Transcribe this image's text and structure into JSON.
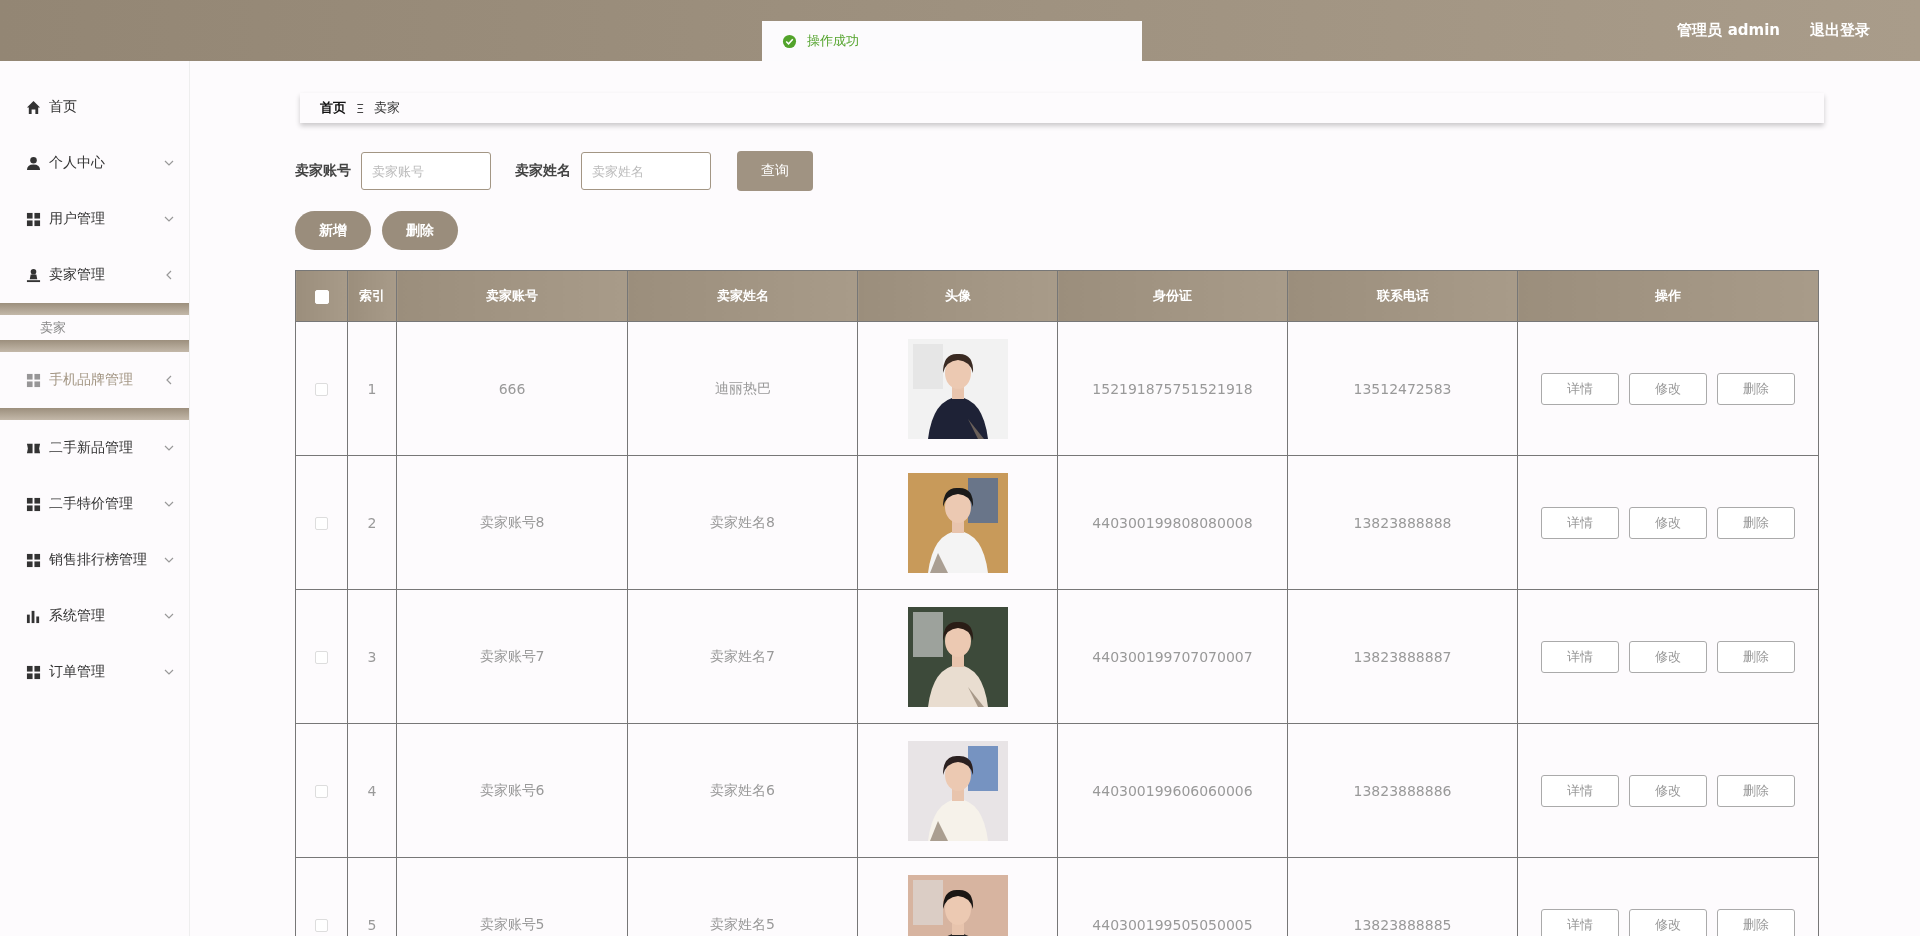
{
  "header": {
    "user": "管理员 admin",
    "logout": "退出登录"
  },
  "toast": {
    "message": "操作成功"
  },
  "sidebar": {
    "items": [
      {
        "label": "首页",
        "highlighted": false
      },
      {
        "label": "个人中心",
        "expanded": false,
        "highlighted": false
      },
      {
        "label": "用户管理",
        "expanded": false,
        "highlighted": false
      },
      {
        "label": "卖家管理",
        "expanded": true,
        "highlighted": false,
        "children": [
          {
            "label": "卖家"
          }
        ]
      },
      {
        "label": "手机品牌管理",
        "expanded": true,
        "highlighted": true
      },
      {
        "label": "二手新品管理",
        "expanded": false,
        "highlighted": false
      },
      {
        "label": "二手特价管理",
        "expanded": false,
        "highlighted": false
      },
      {
        "label": "销售排行榜管理",
        "expanded": false,
        "highlighted": false
      },
      {
        "label": "系统管理",
        "expanded": false,
        "highlighted": false
      },
      {
        "label": "订单管理",
        "expanded": false,
        "highlighted": false
      }
    ]
  },
  "breadcrumb": {
    "items": [
      "首页",
      "卖家"
    ],
    "separator": "Ξ"
  },
  "search": {
    "fields": [
      {
        "label": "卖家账号",
        "placeholder": "卖家账号"
      },
      {
        "label": "卖家姓名",
        "placeholder": "卖家姓名"
      }
    ],
    "button": "查询"
  },
  "actions": [
    "新增",
    "删除"
  ],
  "table": {
    "header_checked": false,
    "columns": [
      "索引",
      "卖家账号",
      "卖家姓名",
      "头像",
      "身份证",
      "联系电话",
      "操作"
    ],
    "rows": [
      {
        "checked": false,
        "cells": [
          "1",
          "666",
          "迪丽热巴",
          "",
          "152191875751521918",
          "13512472583"
        ],
        "avatar": {
          "kind": "picture"
        },
        "buttons": [
          "详情",
          "修改",
          "删除"
        ]
      },
      {
        "checked": false,
        "cells": [
          "2",
          "卖家账号8",
          "卖家姓名8",
          "",
          "440300199808080008",
          "13823888888"
        ],
        "avatar": {
          "kind": "picture"
        },
        "buttons": [
          "详情",
          "修改",
          "删除"
        ]
      },
      {
        "checked": false,
        "cells": [
          "3",
          "卖家账号7",
          "卖家姓名7",
          "",
          "440300199707070007",
          "13823888887"
        ],
        "avatar": {
          "kind": "picture"
        },
        "buttons": [
          "详情",
          "修改",
          "删除"
        ]
      },
      {
        "checked": false,
        "cells": [
          "4",
          "卖家账号6",
          "卖家姓名6",
          "",
          "440300199606060006",
          "13823888886"
        ],
        "avatar": {
          "kind": "picture"
        },
        "buttons": [
          "详情",
          "修改",
          "删除"
        ]
      },
      {
        "checked": false,
        "cells": [
          "5",
          "卖家账号5",
          "卖家姓名5",
          "",
          "440300199505050005",
          "13823888885"
        ],
        "avatar": {
          "kind": "picture"
        },
        "buttons": [
          "详情",
          "修改",
          "删除"
        ]
      }
    ]
  }
}
